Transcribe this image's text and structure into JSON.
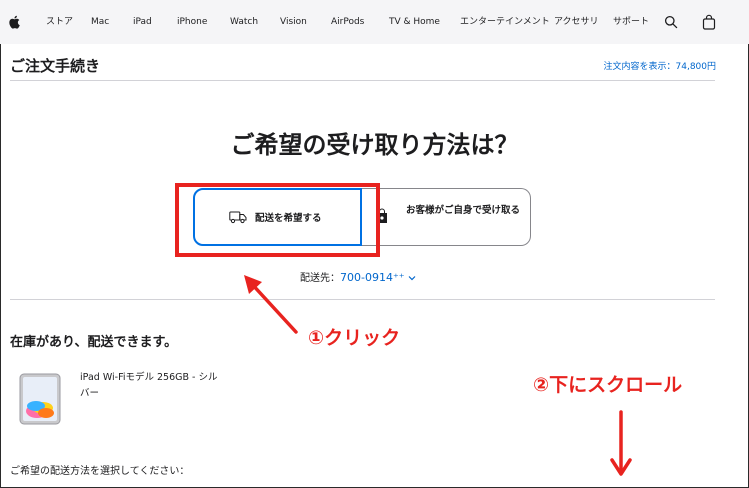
{
  "nav": {
    "items": [
      "ストア",
      "Mac",
      "iPad",
      "iPhone",
      "Watch",
      "Vision",
      "AirPods",
      "TV & Home",
      "エンターテインメント",
      "アクセサリ",
      "サポート"
    ],
    "icons": [
      "apple-logo-icon",
      "search-icon",
      "bag-icon"
    ]
  },
  "header": {
    "title": "ご注文手続き",
    "order_summary": "注文内容を表示：74,800円"
  },
  "main": {
    "question": "ご希望の受け取り方法は？",
    "options": {
      "delivery": {
        "label": "配送を希望する",
        "icon": "truck-icon"
      },
      "pickup": {
        "label": "お客様がご自身で受け取る",
        "icon": "apple-bag-icon"
      }
    },
    "ship_to_label": "配送先：",
    "ship_to_zip": "700-0914",
    "ship_to_suffix": "⁺⁺",
    "stock_heading": "在庫があり、配送できます。",
    "product_name": "iPad Wi-Fiモデル 256GB - シルバー",
    "method_prompt": "ご希望の配送方法を選択してください："
  },
  "annotations": {
    "step1": "①クリック",
    "step2": "②下にスクロール",
    "color": "#e8231f"
  },
  "colors": {
    "accent_link": "#0066cc",
    "selected_border": "#0071e3",
    "nav_bg": "#f5f5f7"
  }
}
